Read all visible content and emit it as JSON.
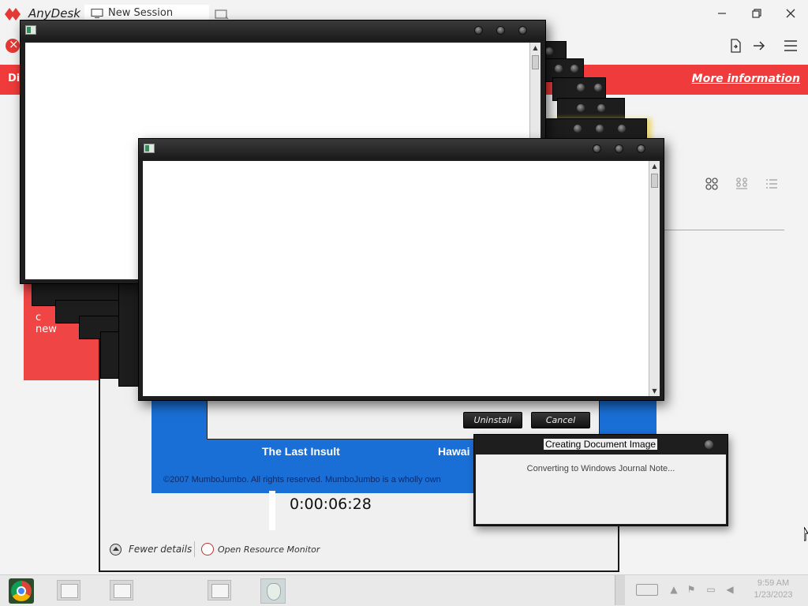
{
  "anydesk": {
    "app_name": "AnyDesk",
    "tab_label": "New Session",
    "banner_text": "Di",
    "banner_link": "More information",
    "card_text_line1": "c",
    "card_text_line2": "new",
    "colors": {
      "brand_red": "#ef3b3b",
      "background": "#f3f3f3"
    }
  },
  "uninstaller": {
    "game_title_1": "The Last Insult",
    "game_title_2": "Hawai",
    "copyright": "©2007 MumboJumbo. All rights reserved. MumboJumbo is a wholly own",
    "uninstall_label": "Uninstall",
    "cancel_label": "Cancel",
    "elapsed_time": "0:00:06:28",
    "fewer_details_label": "Fewer details",
    "resource_monitor_label": "Open Resource Monitor",
    "colors": {
      "banner_blue": "#1a6fd6"
    }
  },
  "doc_image_dialog": {
    "title": "Creating Document Image",
    "message": "Converting to Windows Journal Note..."
  },
  "taskbar": {
    "clock_time": "9:59 AM",
    "clock_date": "1/23/2023"
  }
}
